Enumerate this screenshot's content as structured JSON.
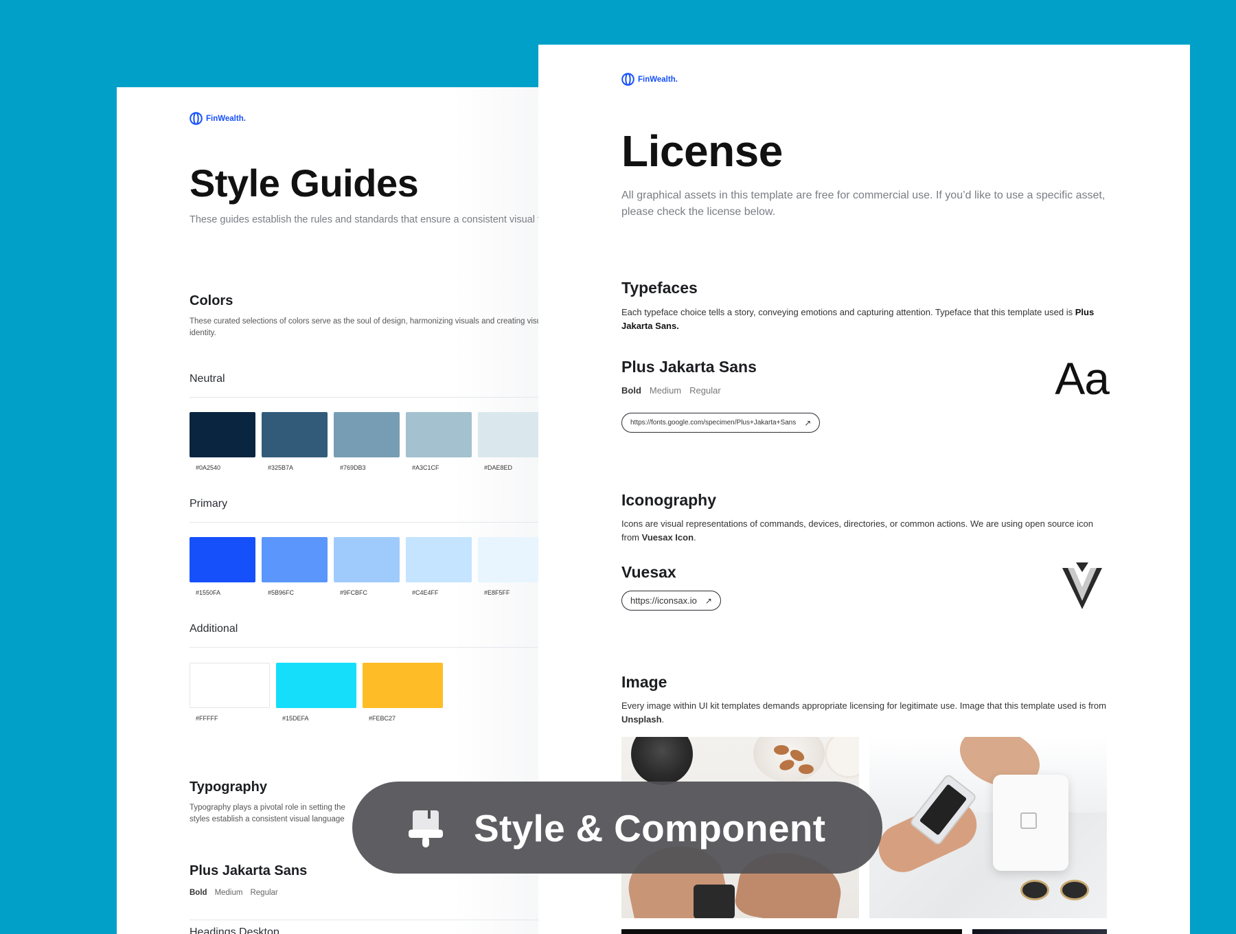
{
  "left_page": {
    "logo": {
      "text": "FinWealth."
    },
    "title": "Style Guides",
    "description": "These guides establish the rules and standards that ensure a consistent visual template",
    "colors": {
      "heading": "Colors",
      "description": "These curated selections of colors serve as the soul of design, harmonizing visuals and creating visual identity.",
      "groups": [
        {
          "name": "Neutral",
          "swatches": [
            {
              "hex": "#0A2540",
              "label": "#0A2540"
            },
            {
              "hex": "#325B7A",
              "label": "#325B7A"
            },
            {
              "hex": "#769DB3",
              "label": "#769DB3"
            },
            {
              "hex": "#A3C1CF",
              "label": "#A3C1CF"
            },
            {
              "hex": "#DAE8ED",
              "label": "#DAE8ED"
            }
          ]
        },
        {
          "name": "Primary",
          "swatches": [
            {
              "hex": "#1550FA",
              "label": "#1550FA"
            },
            {
              "hex": "#5B96FC",
              "label": "#5B96FC"
            },
            {
              "hex": "#9FCBFC",
              "label": "#9FCBFC"
            },
            {
              "hex": "#C4E4FF",
              "label": "#C4E4FF"
            },
            {
              "hex": "#E8F5FF",
              "label": "#E8F5FF"
            }
          ]
        },
        {
          "name": "Additional",
          "swatches": [
            {
              "hex": "#FFFFFF",
              "label": "#FFFFF"
            },
            {
              "hex": "#15DEFA",
              "label": "#15DEFA"
            },
            {
              "hex": "#FEBC27",
              "label": "#FEBC27"
            }
          ]
        }
      ]
    },
    "typography": {
      "heading": "Typography",
      "description": "Typography plays a pivotal role in setting the styles establish a consistent visual language",
      "font_name": "Plus Jakarta Sans",
      "weights": {
        "bold": "Bold",
        "medium": "Medium",
        "regular": "Regular"
      },
      "next_heading": "Headings Desktop"
    }
  },
  "right_page": {
    "logo": {
      "text": "FinWealth."
    },
    "title": "License",
    "description": "All graphical assets in this template are free for commercial use. If you’d like to use a specific asset, please check the license below.",
    "typefaces": {
      "heading": "Typefaces",
      "description_pre": " Each typeface choice tells a story, conveying emotions and capturing attention. Typeface that this template used is ",
      "description_bold": "Plus Jakarta Sans.",
      "font_name": "Plus Jakarta Sans",
      "weights": {
        "bold": "Bold",
        "medium": "Medium",
        "regular": "Regular"
      },
      "sample": "Aa",
      "link": "https://fonts.google.com/specimen/Plus+Jakarta+Sans"
    },
    "iconography": {
      "heading": "Iconography",
      "description_pre": "Icons are visual representations of commands, devices, directories, or common actions. We are using open source icon from ",
      "description_bold": "Vuesax Icon",
      "description_post": ".",
      "name": "Vuesax",
      "link": "https://iconsax.io"
    },
    "image": {
      "heading": "Image",
      "description_pre": "Every image within UI kit templates demands appropriate licensing for legitimate use. Image that this template used is from ",
      "description_bold": "Unsplash",
      "description_post": "."
    }
  },
  "banner": {
    "icon": "paint-brush-icon",
    "text": "Style & Component"
  },
  "colors": {
    "background": "#00A0C8",
    "brand": "#1550FA",
    "banner_bg": "#525256"
  }
}
